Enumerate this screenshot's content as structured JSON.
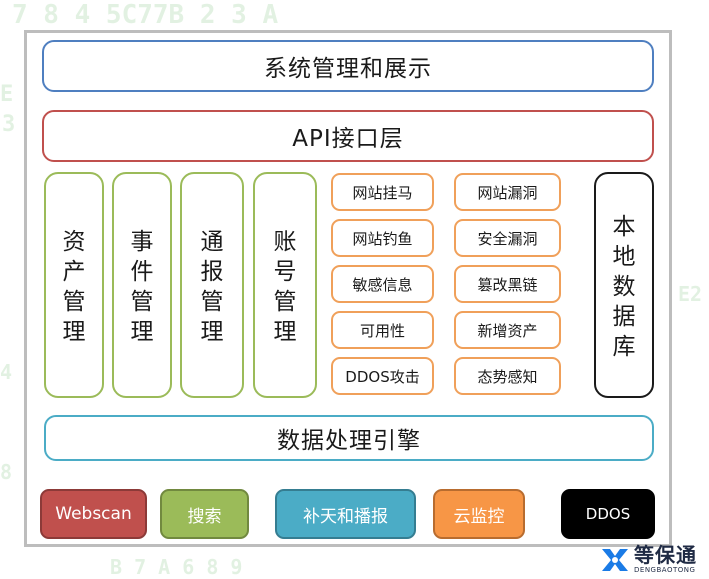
{
  "layers": {
    "top": "系统管理和展示",
    "api": "API接口层",
    "engine": "数据处理引擎"
  },
  "modules": [
    "资产管理",
    "事件管理",
    "通报管理",
    "账号管理"
  ],
  "grid_left": [
    "网站挂马",
    "网站钓鱼",
    "敏感信息",
    "可用性",
    "DDOS攻击"
  ],
  "grid_right": [
    "网站漏洞",
    "安全漏洞",
    "篡改黑链",
    "新增资产",
    "态势感知"
  ],
  "database": "本地数据库",
  "buttons": [
    "Webscan",
    "搜索",
    "补天和播报",
    "云监控",
    "DDOS"
  ],
  "logo": {
    "cn": "等保通",
    "en": "DENGBAOTONG"
  },
  "colors": {
    "blue": "#4f7fc0",
    "red": "#c0504d",
    "green": "#9bbb59",
    "orange": "#f0a05a",
    "cyan": "#4bacc6",
    "black": "#1a1a1a",
    "btn_red": "#c0504d",
    "btn_green": "#9bbb59",
    "btn_cyan": "#4bacc6",
    "btn_orange": "#f79646",
    "btn_black": "#000000",
    "logo_blue": "#1a7be6"
  }
}
